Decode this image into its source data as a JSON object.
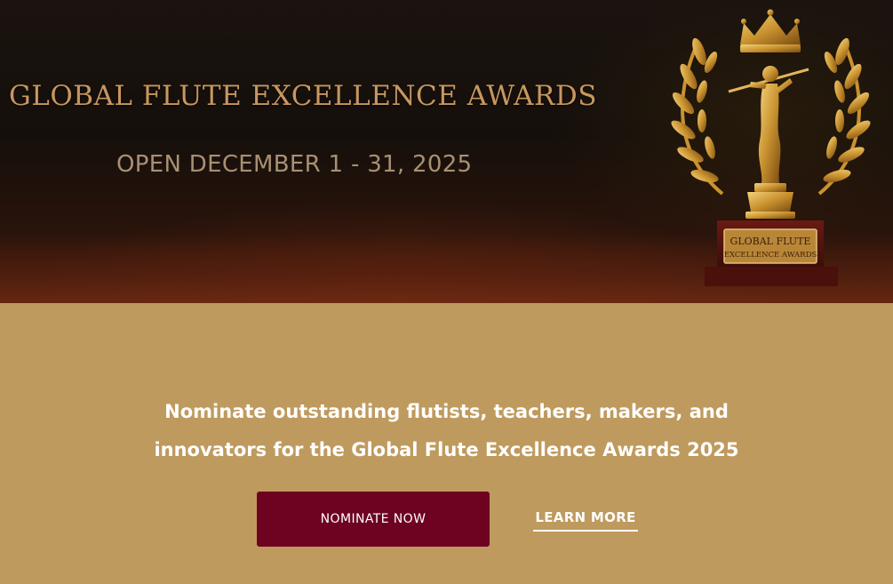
{
  "hero": {
    "title": "GLOBAL FLUTE EXCELLENCE AWARDS",
    "dates": "OPEN DECEMBER 1 - 31, 2025",
    "plaque_line1": "GLOBAL FLUTE",
    "plaque_line2": "EXCELLENCE AWARDS",
    "trophy_icon": "golden-flutist-trophy-with-laurels-and-crown"
  },
  "content": {
    "tagline_line1": "Nominate outstanding flutists, teachers, makers, and",
    "tagline_line2": "innovators for the Global Flute Excellence Awards 2025",
    "primary_button": "NOMINATE NOW",
    "secondary_link": "LEARN MORE"
  },
  "colors": {
    "hero_background": "#150f0b",
    "hero_title": "#c7975f",
    "content_background": "#bf9a5e",
    "primary_button": "#6d0321",
    "gold": "#d4a24a"
  }
}
